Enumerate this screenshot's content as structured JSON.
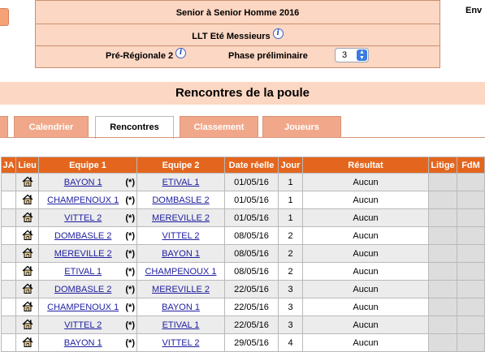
{
  "header": {
    "competition": "Senior  à Senior  Homme  2016",
    "event": "LLT Eté Messieurs",
    "division": "Pré-Régionale 2",
    "phase_label": "Phase préliminaire",
    "phase_value": "3",
    "top_right": "Env"
  },
  "page_title": "Rencontres de la poule",
  "tabs": [
    "Calendrier",
    "Rencontres",
    "Classement",
    "Joueurs"
  ],
  "active_tab": "Rencontres",
  "columns": [
    "JA",
    "Lieu",
    "Equipe 1",
    "Equipe 2",
    "Date réelle",
    "Jour",
    "Résultat",
    "Litige",
    "FdM"
  ],
  "rows": [
    {
      "team1": "BAYON 1",
      "star": "(*)",
      "team2": "ETIVAL 1",
      "date": "01/05/16",
      "day": "1",
      "result": "Aucun"
    },
    {
      "team1": "CHAMPENOUX 1",
      "star": "(*)",
      "team2": "DOMBASLE 2",
      "date": "01/05/16",
      "day": "1",
      "result": "Aucun"
    },
    {
      "team1": "VITTEL 2",
      "star": "(*)",
      "team2": "MEREVILLE 2",
      "date": "01/05/16",
      "day": "1",
      "result": "Aucun"
    },
    {
      "team1": "DOMBASLE 2",
      "star": "(*)",
      "team2": "VITTEL 2",
      "date": "08/05/16",
      "day": "2",
      "result": "Aucun"
    },
    {
      "team1": "MEREVILLE 2",
      "star": "(*)",
      "team2": "BAYON 1",
      "date": "08/05/16",
      "day": "2",
      "result": "Aucun"
    },
    {
      "team1": "ETIVAL 1",
      "star": "(*)",
      "team2": "CHAMPENOUX 1",
      "date": "08/05/16",
      "day": "2",
      "result": "Aucun"
    },
    {
      "team1": "DOMBASLE 2",
      "star": "(*)",
      "team2": "MEREVILLE 2",
      "date": "22/05/16",
      "day": "3",
      "result": "Aucun"
    },
    {
      "team1": "CHAMPENOUX 1",
      "star": "(*)",
      "team2": "BAYON 1",
      "date": "22/05/16",
      "day": "3",
      "result": "Aucun"
    },
    {
      "team1": "VITTEL 2",
      "star": "(*)",
      "team2": "ETIVAL 1",
      "date": "22/05/16",
      "day": "3",
      "result": "Aucun"
    },
    {
      "team1": "BAYON 1",
      "star": "(*)",
      "team2": "VITTEL 2",
      "date": "29/05/16",
      "day": "4",
      "result": "Aucun"
    }
  ],
  "icons": {
    "venue": "house-icon",
    "info": "info-icon"
  },
  "colors": {
    "accent": "#e4661e",
    "header_bg": "#fcd7c3",
    "tab": "#f1a88a",
    "link": "#1e1ea0"
  }
}
